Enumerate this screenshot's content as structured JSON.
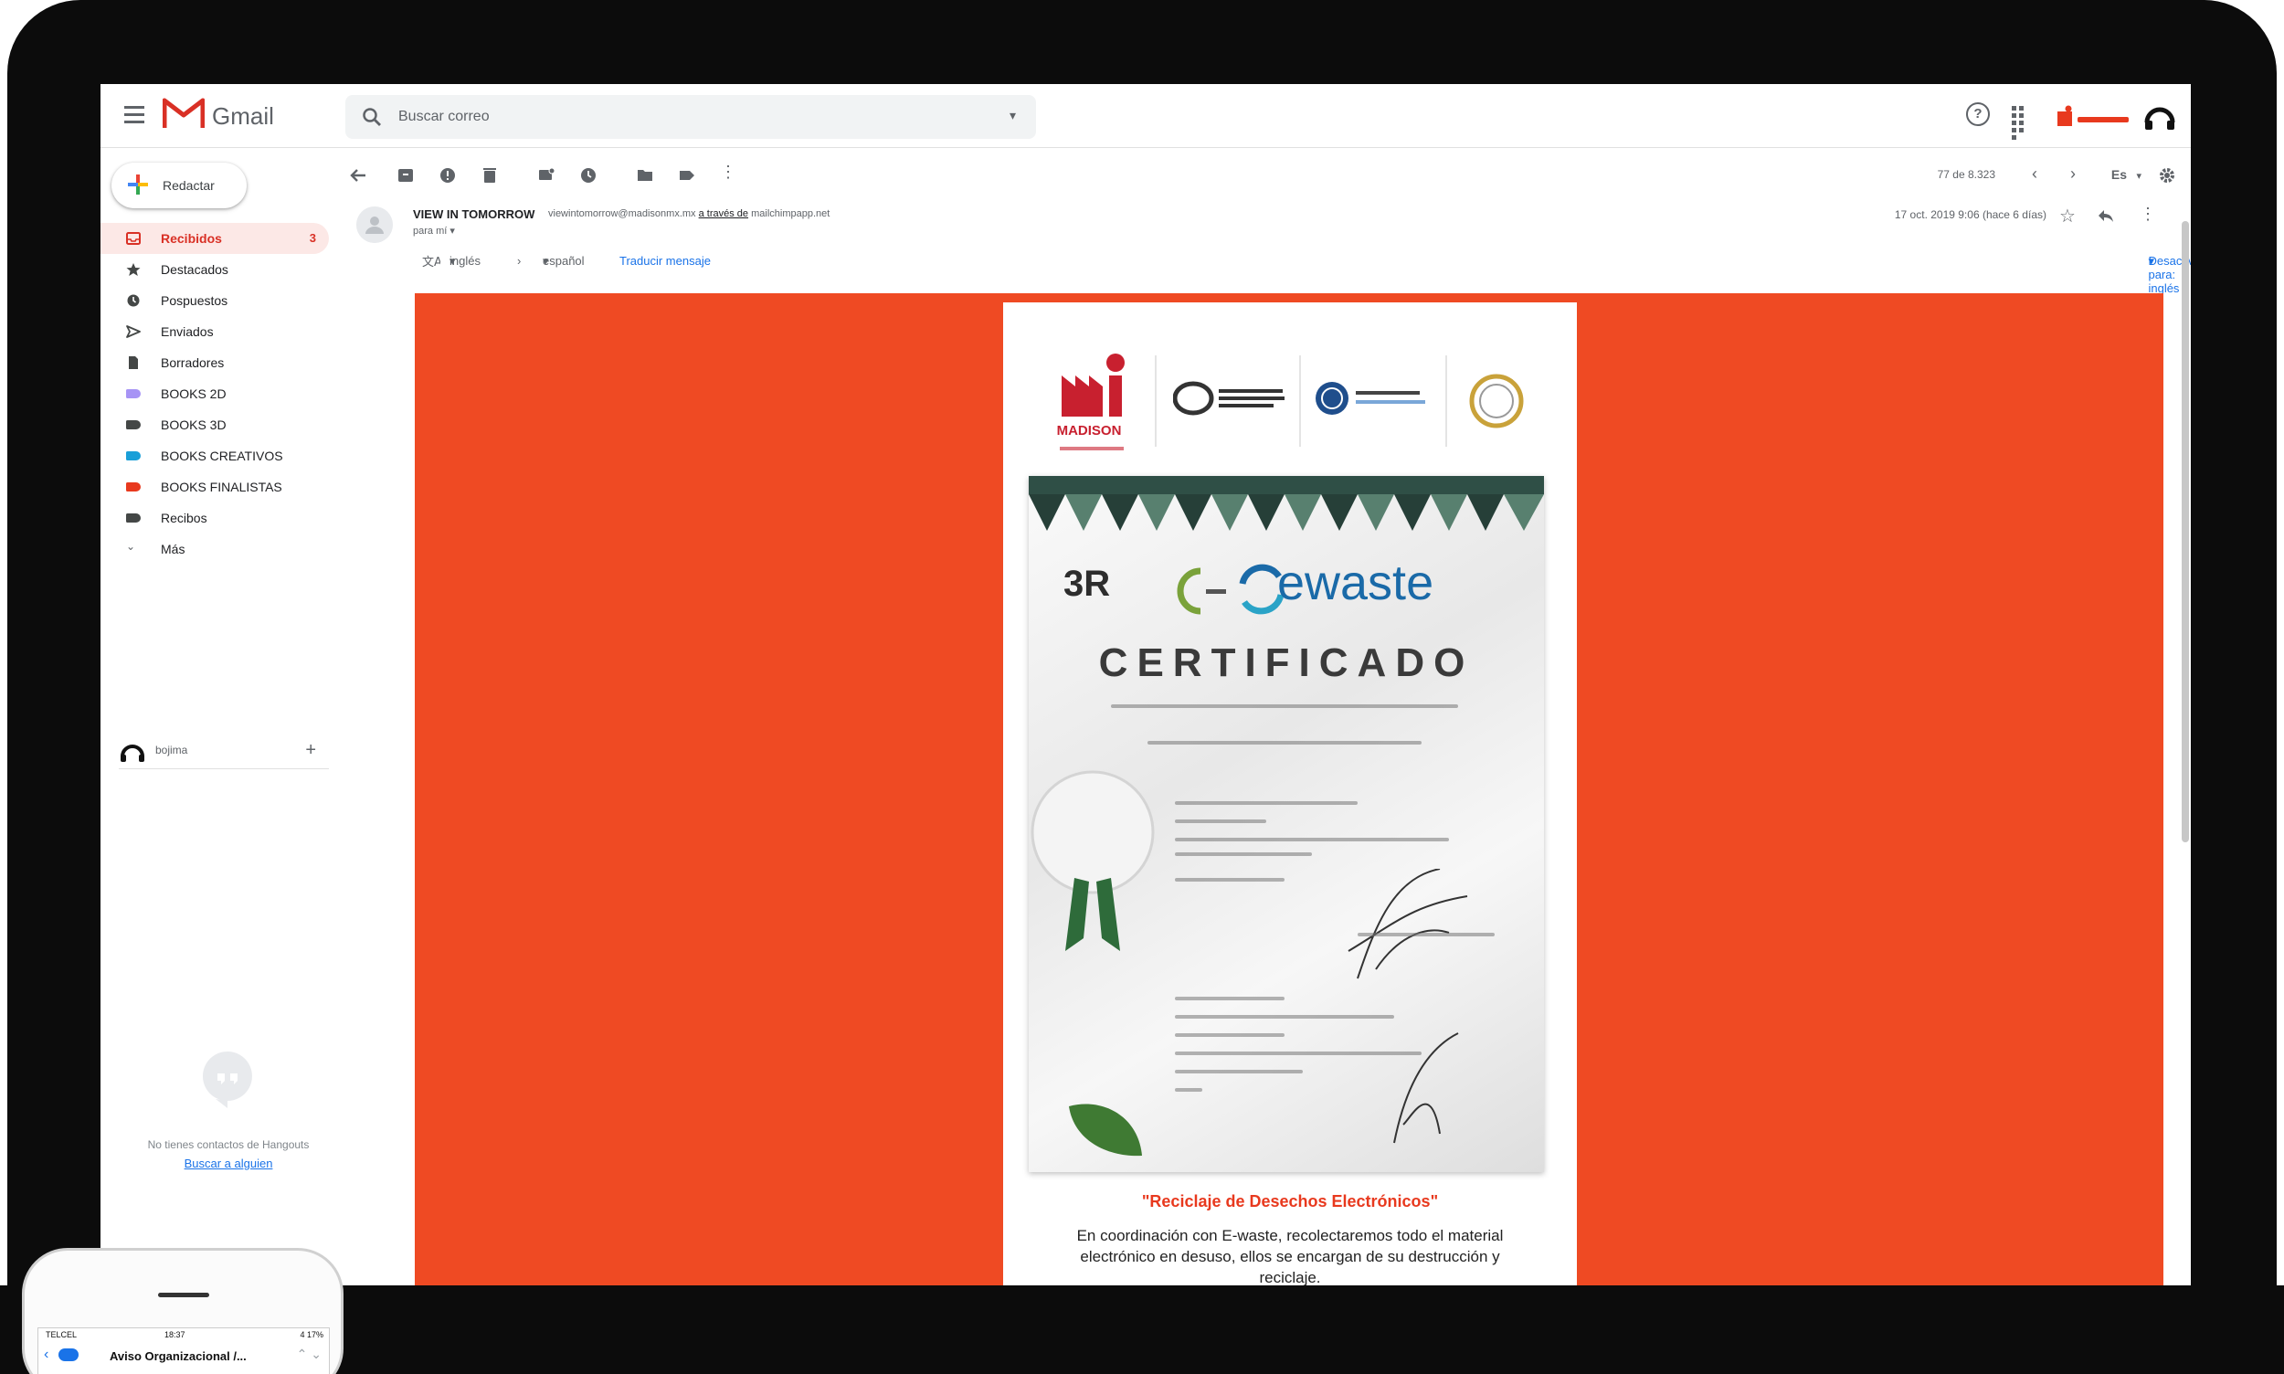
{
  "gmail": {
    "logo_text": "Gmail",
    "search_placeholder": "Buscar correo",
    "compose_label": "Redactar"
  },
  "sidebar": {
    "items": [
      {
        "label": "Recibidos",
        "count": "3",
        "icon": "inbox-icon",
        "active": true
      },
      {
        "label": "Destacados",
        "icon": "star-icon"
      },
      {
        "label": "Pospuestos",
        "icon": "clock-icon"
      },
      {
        "label": "Enviados",
        "icon": "send-icon"
      },
      {
        "label": "Borradores",
        "icon": "draft-icon"
      },
      {
        "label": "BOOKS 2D",
        "icon": "label-icon",
        "color": "#a794f5"
      },
      {
        "label": "BOOKS 3D",
        "icon": "label-icon",
        "color": "#444746"
      },
      {
        "label": "BOOKS CREATIVOS",
        "icon": "label-icon",
        "color": "#1a9fd8"
      },
      {
        "label": "BOOKS FINALISTAS",
        "icon": "label-icon",
        "color": "#e8391e"
      },
      {
        "label": "Recibos",
        "icon": "label-icon",
        "color": "#444746"
      },
      {
        "label": "Más",
        "icon": "chevron-down-icon"
      }
    ],
    "hangouts_user": "bojima",
    "hangouts_empty": "No tienes contactos de Hangouts",
    "hangouts_link": "Buscar a alguien"
  },
  "toolbar": {
    "pager": "77 de 8.323",
    "lang_label": "Es"
  },
  "message": {
    "sender_name": "VIEW IN TOMORROW",
    "sender_email": "viewintomorrow@madisonmx.mx",
    "via_label": "a través de",
    "via_domain": "mailchimpapp.net",
    "to_label": "para mí",
    "date": "17 oct. 2019 9:06 (hace 6 días)"
  },
  "translate": {
    "from_lang": "inglés",
    "to_lang": "español",
    "action": "Traducir mensaje",
    "disable": "Desactivar para: inglés"
  },
  "email": {
    "brand": "MADISON",
    "certificate_title": "CERTIFICADO",
    "ewaste_logo": "ewaste",
    "threer_logo": "3R",
    "headline": "\"Reciclaje de Desechos Electrónicos\"",
    "body": "En coordinación con E-waste, recolectaremos todo el material electrónico en desuso, ellos se encargan de su destrucción y reciclaje."
  },
  "phone": {
    "carrier": "TELCEL",
    "time": "18:37",
    "battery": "4 17%",
    "title": "Aviso Organizacional /..."
  },
  "colors": {
    "gmail_red": "#d93025",
    "email_background": "#ef4a23",
    "accent_blue": "#1a73e8"
  }
}
